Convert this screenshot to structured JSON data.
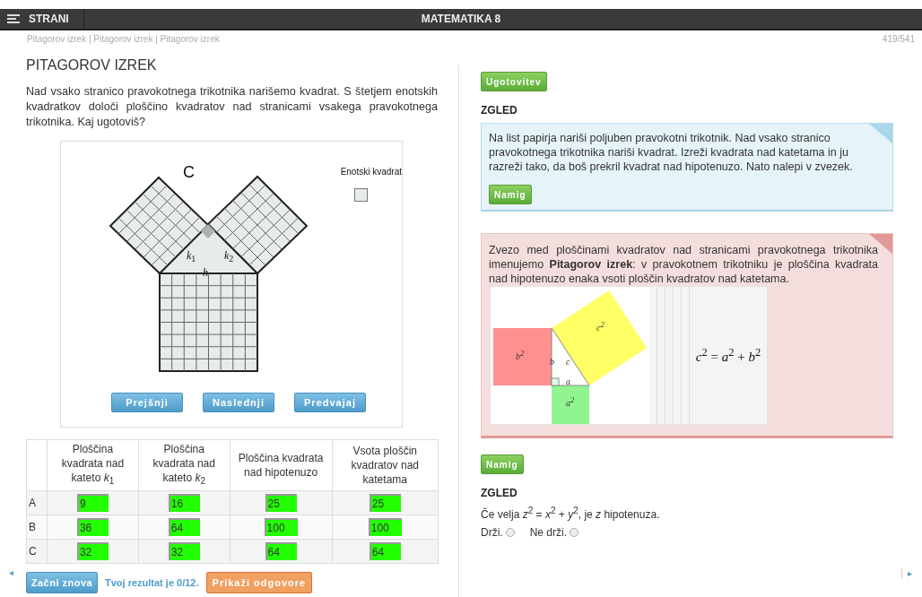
{
  "top_bar": {
    "menu_label": "STRANI",
    "title": "MATEMATIKA 8"
  },
  "breadcrumb": "Pitagorov izrek | Pitagorov izrek | Pitagorov izrek",
  "page_counter": "419/541",
  "heading": "PITAGOROV IZREK",
  "intro": "Nad vsako stranico pravokotnega trikotnika narišemo kvadrat. S štetjem enotskih kvadratkov določi ploščino kvadratov nad stranicami vsakega pravokotnega trikotnika. Kaj ugotoviš?",
  "diagram": {
    "label": "C",
    "unit_label": "Enotski kvadrat",
    "side_labels": [
      "*k*$_{1}$",
      "*k*$_{2}$",
      "*h*"
    ],
    "buttons": [
      "Prejšnji",
      "Naslednji",
      "Predvajaj"
    ]
  },
  "table": {
    "columns": [
      "Ploščina kvadrata nad kateto *k*$_{1}$",
      "Ploščina kvadrata nad kateto *k*$_{2}$",
      "Ploščina kvadrata nad hipotenuzo",
      "Vsota ploščin kvadratov nad katetama"
    ],
    "rows": [
      {
        "label": "A",
        "cells": [
          {
            "value": "9",
            "correct": true
          },
          {
            "value": "16",
            "correct": true
          },
          {
            "value": "25",
            "correct": true
          },
          {
            "value": "25",
            "correct": true
          }
        ]
      },
      {
        "label": "B",
        "cells": [
          {
            "value": "36",
            "correct": true
          },
          {
            "value": "64",
            "correct": true
          },
          {
            "value": "100",
            "correct": true
          },
          {
            "value": "100",
            "correct": true
          }
        ]
      },
      {
        "label": "C",
        "cells": [
          {
            "value": "32",
            "correct": true
          },
          {
            "value": "32",
            "correct": true
          },
          {
            "value": "64",
            "correct": true
          },
          {
            "value": "64",
            "correct": true
          }
        ]
      }
    ]
  },
  "actions": {
    "restart": "Začni znova",
    "result": "Tvoj rezultat je 0/12.",
    "show_answers": "Prikaži odgovore"
  },
  "conclusion_button": "Ugotovitev",
  "example": {
    "heading": "ZGLED",
    "text": "Na list papirja nariši poljuben pravokotni trikotnik. Nad vsako stranico pravokotnega trikotnika nariši kvadrat. Izreži kvadrata nad katetama in ju razreži tako, da boš prekril kvadrat nad hipotenuzo. Nato nalepi v zvezek.",
    "hint_button": "Namig"
  },
  "theorem": {
    "text": "Zvezo med ploščinami kvadratov nad stranicami pravokotnega trikotnika imenujemo **Pitagorov izrek**: v pravokotnem trikotniku je ploščina kvadrata nad hipotenuzo enaka vsoti ploščin kvadratov nad katetama.",
    "figure_labels": [
      "*b*$^{2}$",
      "*c*$^{2}$",
      "*a*$^{2}$",
      "*b*",
      "*c*",
      "*a*"
    ],
    "formula": "*c*$^{2}$ = *a*$^{2}$ + *b*$^{2}$"
  },
  "quiz": {
    "hint_button": "Namig",
    "heading": "ZGLED",
    "statement": "Če velja *z*$^{2}$ = *x*$^{2}$ + *y*$^{2}$, je *z* hipotenuza.",
    "options": [
      {
        "label": "Drži.",
        "selected": false
      },
      {
        "label": "Ne drži.",
        "selected": false
      }
    ]
  },
  "nav": {
    "prev": "◂",
    "next": "▸"
  }
}
